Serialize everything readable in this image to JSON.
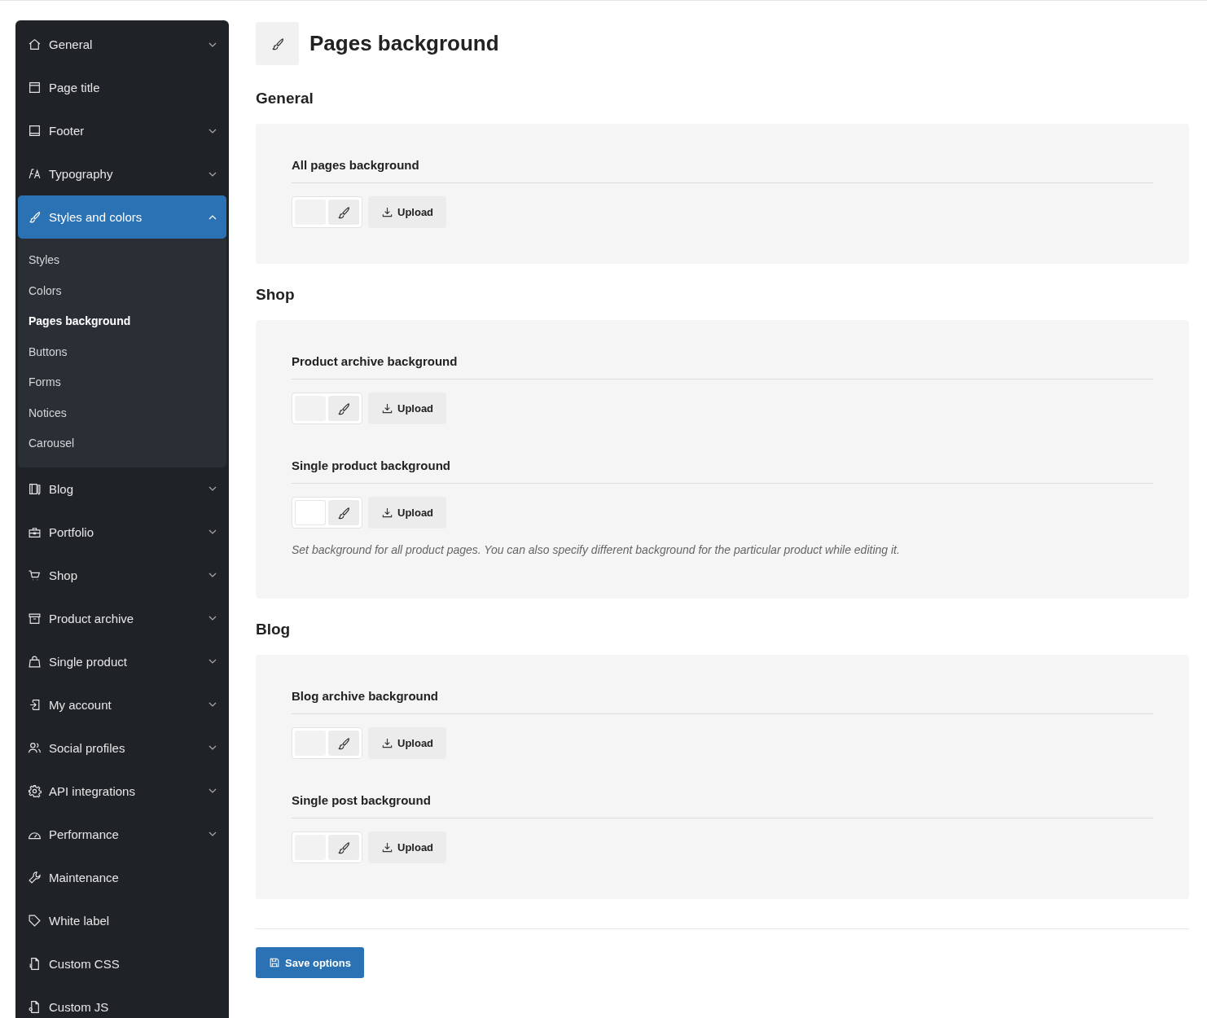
{
  "sidebar": {
    "items": [
      {
        "label": "General",
        "has_submenu": true,
        "expanded": false,
        "selected": false
      },
      {
        "label": "Page title",
        "has_submenu": false,
        "expanded": false,
        "selected": false
      },
      {
        "label": "Footer",
        "has_submenu": true,
        "expanded": false,
        "selected": false
      },
      {
        "label": "Typography",
        "has_submenu": true,
        "expanded": false,
        "selected": false
      },
      {
        "label": "Styles and colors",
        "has_submenu": true,
        "expanded": true,
        "selected": true,
        "children": [
          {
            "label": "Styles",
            "selected": false
          },
          {
            "label": "Colors",
            "selected": false
          },
          {
            "label": "Pages background",
            "selected": true
          },
          {
            "label": "Buttons",
            "selected": false
          },
          {
            "label": "Forms",
            "selected": false
          },
          {
            "label": "Notices",
            "selected": false
          },
          {
            "label": "Carousel",
            "selected": false
          }
        ]
      },
      {
        "label": "Blog",
        "has_submenu": true,
        "expanded": false,
        "selected": false
      },
      {
        "label": "Portfolio",
        "has_submenu": true,
        "expanded": false,
        "selected": false
      },
      {
        "label": "Shop",
        "has_submenu": true,
        "expanded": false,
        "selected": false
      },
      {
        "label": "Product archive",
        "has_submenu": true,
        "expanded": false,
        "selected": false
      },
      {
        "label": "Single product",
        "has_submenu": true,
        "expanded": false,
        "selected": false
      },
      {
        "label": "My account",
        "has_submenu": true,
        "expanded": false,
        "selected": false
      },
      {
        "label": "Social profiles",
        "has_submenu": true,
        "expanded": false,
        "selected": false
      },
      {
        "label": "API integrations",
        "has_submenu": true,
        "expanded": false,
        "selected": false
      },
      {
        "label": "Performance",
        "has_submenu": true,
        "expanded": false,
        "selected": false
      },
      {
        "label": "Maintenance",
        "has_submenu": false,
        "expanded": false,
        "selected": false
      },
      {
        "label": "White label",
        "has_submenu": false,
        "expanded": false,
        "selected": false
      },
      {
        "label": "Custom CSS",
        "has_submenu": false,
        "expanded": false,
        "selected": false
      },
      {
        "label": "Custom JS",
        "has_submenu": false,
        "expanded": false,
        "selected": false
      }
    ]
  },
  "page": {
    "title": "Pages background"
  },
  "sections": [
    {
      "title": "General",
      "fields": [
        {
          "label": "All pages background",
          "upload": "Upload"
        }
      ]
    },
    {
      "title": "Shop",
      "fields": [
        {
          "label": "Product archive background",
          "upload": "Upload"
        },
        {
          "label": "Single product background",
          "upload": "Upload",
          "color": "#ffffff",
          "hint": "Set background for all product pages. You can also specify different background for the particular product while editing it."
        }
      ]
    },
    {
      "title": "Blog",
      "fields": [
        {
          "label": "Blog archive background",
          "upload": "Upload"
        },
        {
          "label": "Single post background",
          "upload": "Upload"
        }
      ]
    }
  ],
  "save_button": "Save options"
}
